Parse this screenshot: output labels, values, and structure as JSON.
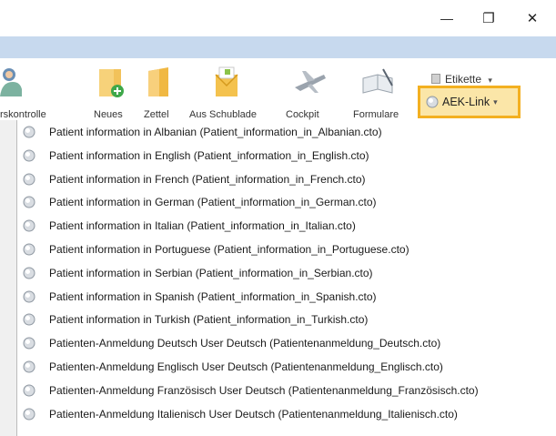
{
  "window": {
    "minimize_glyph": "—",
    "restore_glyph": "❐",
    "close_glyph": "✕"
  },
  "ribbon": {
    "labels": [
      "rskontrolle",
      "Neues",
      "Zettel",
      "Aus Schublade",
      "Cockpit",
      "Formulare"
    ],
    "etikette_label": "Etikette",
    "etikette_caret": "▾",
    "aek_label": "AEK-Link",
    "aek_caret": "▾"
  },
  "menu": {
    "items": [
      "Patient information in Albanian (Patient_information_in_Albanian.cto)",
      "Patient information in English (Patient_information_in_English.cto)",
      "Patient information in French (Patient_information_in_French.cto)",
      "Patient information in German (Patient_information_in_German.cto)",
      "Patient information in Italian (Patient_information_in_Italian.cto)",
      "Patient information in Portuguese (Patient_information_in_Portuguese.cto)",
      "Patient information in Serbian (Patient_information_in_Serbian.cto)",
      "Patient information in Spanish (Patient_information_in_Spanish.cto)",
      "Patient information in Turkish (Patient_information_in_Turkish.cto)",
      "Patienten-Anmeldung Deutsch User Deutsch (Patientenanmeldung_Deutsch.cto)",
      "Patienten-Anmeldung Englisch User Deutsch (Patientenanmeldung_Englisch.cto)",
      "Patienten-Anmeldung Französisch User Deutsch (Patientenanmeldung_Französisch.cto)",
      "Patienten-Anmeldung Italienisch User Deutsch (Patientenanmeldung_Italienisch.cto)"
    ]
  },
  "colors": {
    "accent_border": "#f3b021",
    "accent_fill": "#fbe6a8",
    "tabstrip": "#c7d9ee"
  }
}
